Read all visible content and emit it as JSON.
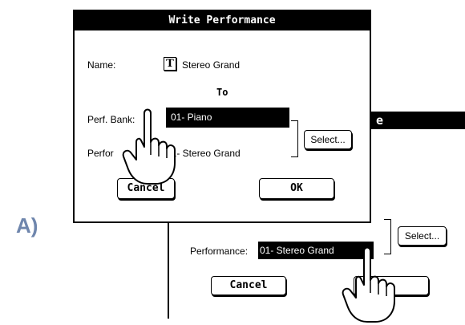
{
  "step_label": "A)",
  "background_dialog": {
    "title_fragment": "e",
    "performance_label": "Performance:",
    "performance_value": "01- Stereo Grand",
    "select_label": "Select...",
    "cancel_label": "Cancel"
  },
  "dialog": {
    "title": "Write Performance",
    "name_label": "Name:",
    "text_edit_icon": "T",
    "name_value": "Stereo Grand",
    "to_label": "To",
    "bank_label": "Perf. Bank:",
    "bank_value": "01- Piano",
    "performance_label": "Perfor",
    "performance_value": "01- Stereo Grand",
    "select_label": "Select...",
    "cancel_label": "Cancel",
    "ok_label": "OK"
  },
  "icons": [
    "pointing-hand-icon",
    "text-edit-icon"
  ]
}
